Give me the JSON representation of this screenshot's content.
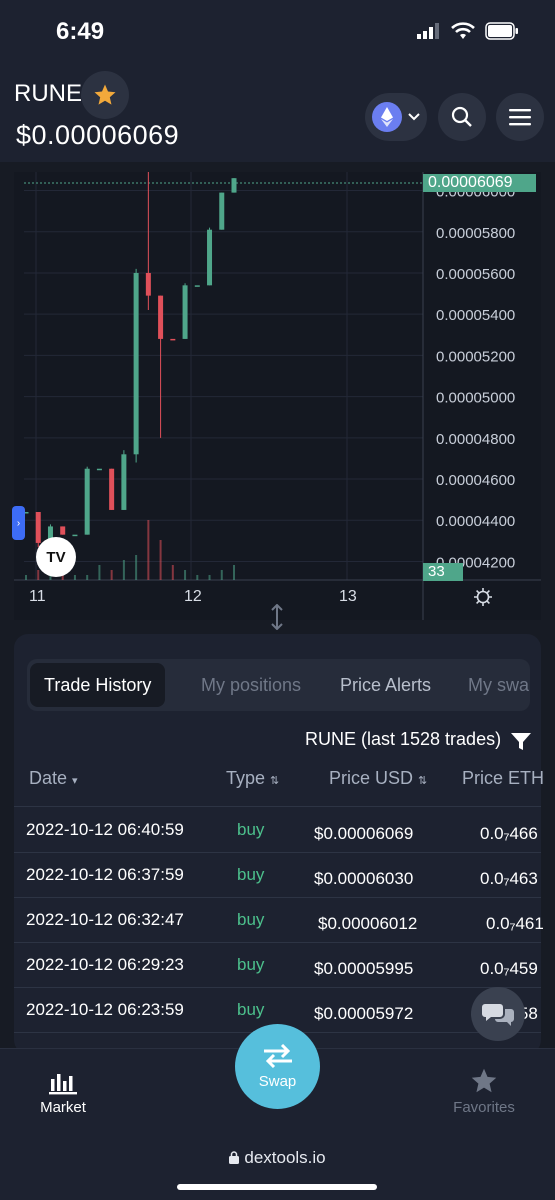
{
  "status_bar": {
    "time": "6:49"
  },
  "header": {
    "token": "RUNE",
    "price": "$0.00006069"
  },
  "chart_data": {
    "type": "candlestick",
    "price_axis": [
      "0.00006000",
      "0.00005800",
      "0.00005600",
      "0.00005400",
      "0.00005200",
      "0.00005000",
      "0.00004800",
      "0.00004600",
      "0.00004400",
      "0.00004200"
    ],
    "current_price_label": "0.00006069",
    "volume_label": "33",
    "x_ticks": [
      "11",
      "12",
      "13"
    ],
    "ylim": [
      4.11e-05,
      6.09e-05
    ],
    "candles": [
      {
        "o": 4.44e-05,
        "h": 4.44e-05,
        "l": 4.44e-05,
        "c": 4.44e-05,
        "up": true
      },
      {
        "o": 4.44e-05,
        "h": 4.44e-05,
        "l": 4.27e-05,
        "c": 4.29e-05,
        "up": false
      },
      {
        "o": 4.29e-05,
        "h": 4.38e-05,
        "l": 4.29e-05,
        "c": 4.37e-05,
        "up": true
      },
      {
        "o": 4.37e-05,
        "h": 4.37e-05,
        "l": 4.33e-05,
        "c": 4.33e-05,
        "up": false
      },
      {
        "o": 4.33e-05,
        "h": 4.33e-05,
        "l": 4.33e-05,
        "c": 4.33e-05,
        "up": true
      },
      {
        "o": 4.33e-05,
        "h": 4.66e-05,
        "l": 4.33e-05,
        "c": 4.65e-05,
        "up": true
      },
      {
        "o": 4.65e-05,
        "h": 4.65e-05,
        "l": 4.65e-05,
        "c": 4.65e-05,
        "up": true
      },
      {
        "o": 4.65e-05,
        "h": 4.65e-05,
        "l": 4.45e-05,
        "c": 4.45e-05,
        "up": false
      },
      {
        "o": 4.45e-05,
        "h": 4.74e-05,
        "l": 4.45e-05,
        "c": 4.72e-05,
        "up": true
      },
      {
        "o": 4.72e-05,
        "h": 5.62e-05,
        "l": 4.68e-05,
        "c": 5.6e-05,
        "up": true
      },
      {
        "o": 5.6e-05,
        "h": 6.09e-05,
        "l": 5.42e-05,
        "c": 5.49e-05,
        "up": false
      },
      {
        "o": 5.49e-05,
        "h": 5.49e-05,
        "l": 4.8e-05,
        "c": 5.28e-05,
        "up": false
      },
      {
        "o": 5.28e-05,
        "h": 5.28e-05,
        "l": 5.28e-05,
        "c": 5.28e-05,
        "up": false
      },
      {
        "o": 5.28e-05,
        "h": 5.55e-05,
        "l": 5.28e-05,
        "c": 5.54e-05,
        "up": true
      },
      {
        "o": 5.54e-05,
        "h": 5.54e-05,
        "l": 5.54e-05,
        "c": 5.54e-05,
        "up": true
      },
      {
        "o": 5.54e-05,
        "h": 5.82e-05,
        "l": 5.54e-05,
        "c": 5.81e-05,
        "up": true
      },
      {
        "o": 5.81e-05,
        "h": 5.99e-05,
        "l": 5.81e-05,
        "c": 5.99e-05,
        "up": true
      },
      {
        "o": 5.99e-05,
        "h": 6.06e-05,
        "l": 5.99e-05,
        "c": 6.06e-05,
        "up": true
      }
    ],
    "volumes": [
      1,
      2,
      1,
      1,
      1,
      1,
      3,
      2,
      4,
      5,
      12,
      8,
      3,
      2,
      1,
      1,
      2,
      3
    ]
  },
  "trades": {
    "tabs": [
      "Trade History",
      "My positions",
      "Price Alerts",
      "My swap"
    ],
    "title": "RUNE (last 1528 trades)",
    "columns": {
      "date": "Date",
      "type": "Type",
      "price_usd": "Price USD",
      "price_eth": "Price ETH"
    },
    "rows": [
      {
        "date": "2022-10-12 06:40:59",
        "type": "buy",
        "price_usd": "$0.00006069",
        "price_eth": "0.0₇466"
      },
      {
        "date": "2022-10-12 06:37:59",
        "type": "buy",
        "price_usd": "$0.00006030",
        "price_eth": "0.0₇463"
      },
      {
        "date": "2022-10-12 06:32:47",
        "type": "buy",
        "price_usd": "$0.00006012",
        "price_eth": "0.0₇461"
      },
      {
        "date": "2022-10-12 06:29:23",
        "type": "buy",
        "price_usd": "$0.00005995",
        "price_eth": "0.0₇459"
      },
      {
        "date": "2022-10-12 06:23:59",
        "type": "buy",
        "price_usd": "$0.00005972",
        "price_eth": "0.0₇458"
      }
    ]
  },
  "nav": {
    "market": "Market",
    "swap": "Swap",
    "favorites": "Favorites"
  },
  "browser": {
    "url": "dextools.io"
  },
  "colors": {
    "up": "#4fa68a",
    "down": "#e0505a",
    "accent": "#56bfdc",
    "star": "#f2a93b"
  }
}
